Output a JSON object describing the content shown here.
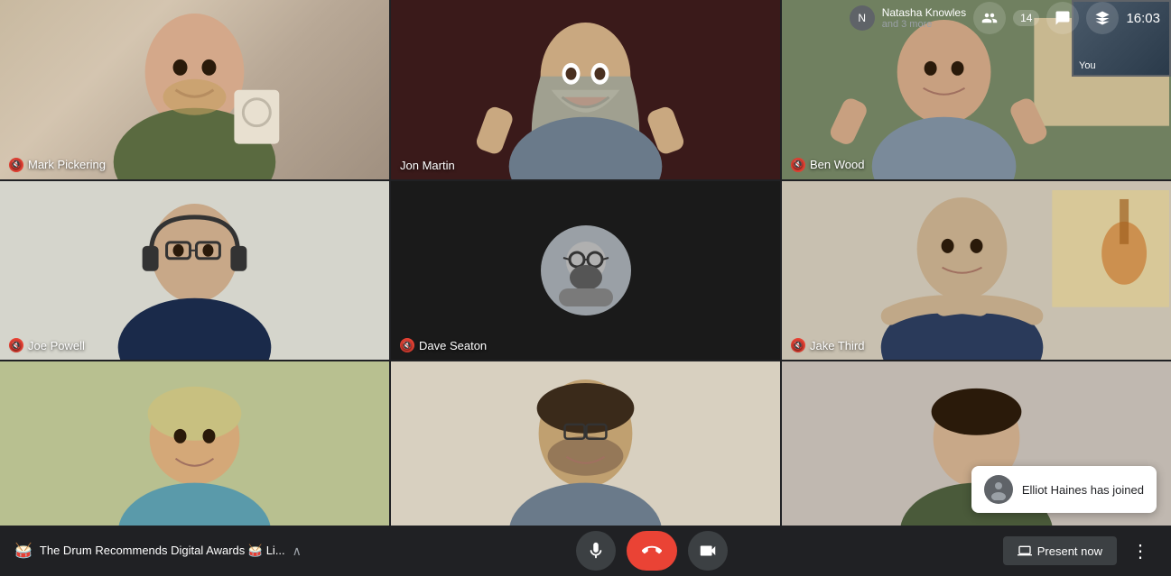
{
  "participants": [
    {
      "id": "mark",
      "name": "Mark Pickering",
      "micOff": true,
      "cellClass": "cell-mark",
      "col": 1,
      "row": 1
    },
    {
      "id": "jon",
      "name": "Jon Martin",
      "micOff": false,
      "cellClass": "cell-jon",
      "col": 2,
      "row": 1
    },
    {
      "id": "ben",
      "name": "Ben Wood",
      "micOff": false,
      "cellClass": "cell-ben",
      "col": 3,
      "row": 1
    },
    {
      "id": "joe",
      "name": "Joe Powell",
      "micOff": true,
      "cellClass": "cell-joe",
      "col": 1,
      "row": 2
    },
    {
      "id": "dave",
      "name": "Dave Seaton",
      "micOff": true,
      "cellClass": "cell-dave",
      "col": 2,
      "row": 2,
      "noVideo": true
    },
    {
      "id": "jake",
      "name": "Jake Third",
      "micOff": true,
      "cellClass": "cell-jake",
      "col": 3,
      "row": 2
    },
    {
      "id": "bottom1",
      "name": "",
      "micOff": false,
      "cellClass": "cell-bottom1",
      "col": 1,
      "row": 3
    },
    {
      "id": "bottom2",
      "name": "",
      "micOff": false,
      "cellClass": "cell-bottom2",
      "col": 2,
      "row": 3
    },
    {
      "id": "bottom3",
      "name": "",
      "micOff": false,
      "cellClass": "cell-bottom3",
      "col": 3,
      "row": 3
    }
  ],
  "topBar": {
    "hostName": "Natasha Knowles",
    "hostSubtext": "and 3 more",
    "participantCount": "14",
    "time": "16:03",
    "selfLabel": "You"
  },
  "bottomBar": {
    "titleEmoji1": "🥁",
    "titleText": "The Drum Recommends Digital Awards",
    "titleEmoji2": "🥁",
    "titleSuffix": "Li...",
    "micLabel": "🎤",
    "endCallLabel": "📞",
    "cameraLabel": "📹",
    "presentLabel": "Present now",
    "moreLabel": "⋮"
  },
  "toast": {
    "name": "Elliot Haines",
    "message": "Elliot Haines has joined"
  },
  "icons": {
    "mic": "🎤",
    "micOff": "🔇",
    "camera": "📹",
    "phone": "📞",
    "present": "📺",
    "people": "👥",
    "chat": "💬",
    "more": "⋮",
    "chevronUp": "^"
  }
}
